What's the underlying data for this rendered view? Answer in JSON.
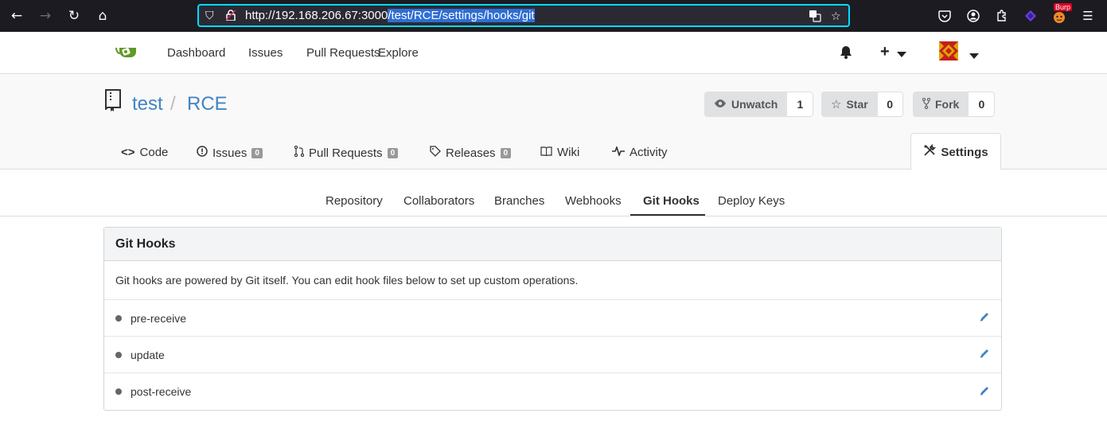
{
  "browser": {
    "url_host": "http://192.168.206.67:3000",
    "url_path": "/test/RCE/settings/hooks/git",
    "burp_badge": "Burp"
  },
  "header": {
    "nav": [
      "Dashboard",
      "Issues",
      "Pull Requests",
      "Explore"
    ]
  },
  "repo": {
    "owner": "test",
    "separator": "/",
    "name": "RCE",
    "watch_label": "Unwatch",
    "watch_count": "1",
    "star_label": "Star",
    "star_count": "0",
    "fork_label": "Fork",
    "fork_count": "0",
    "tabs": {
      "code": "Code",
      "issues": "Issues",
      "issues_count": "0",
      "pulls": "Pull Requests",
      "pulls_count": "0",
      "releases": "Releases",
      "releases_count": "0",
      "wiki": "Wiki",
      "activity": "Activity",
      "settings": "Settings"
    }
  },
  "settings_nav": [
    "Repository",
    "Collaborators",
    "Branches",
    "Webhooks",
    "Git Hooks",
    "Deploy Keys"
  ],
  "panel": {
    "title": "Git Hooks",
    "description": "Git hooks are powered by Git itself. You can edit hook files below to set up custom operations.",
    "hooks": [
      "pre-receive",
      "update",
      "post-receive"
    ]
  },
  "colors": {
    "link": "#4183c4",
    "browser_bg": "#1c1b22",
    "url_focus": "#00ddff"
  }
}
